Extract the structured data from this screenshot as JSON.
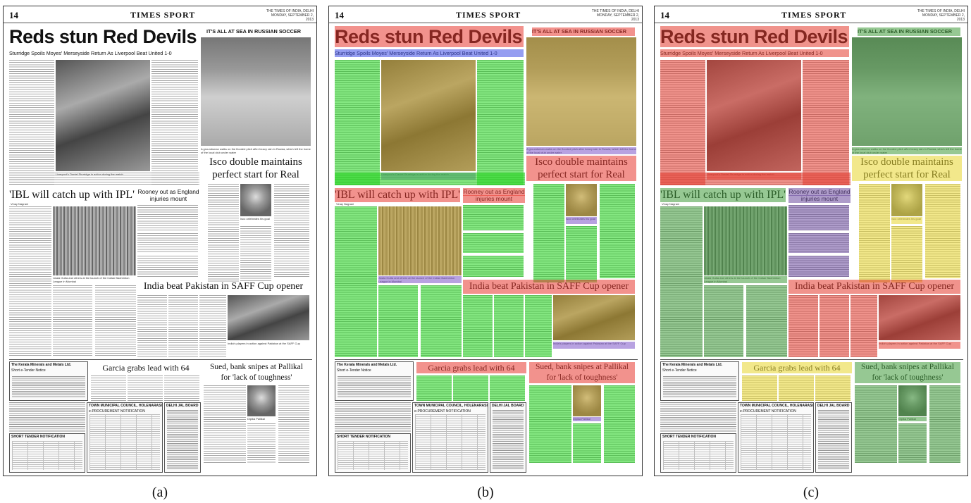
{
  "page": {
    "number": "14",
    "section": "TIMES SPORT",
    "edition": "THE TIMES OF INDIA, DELHI MONDAY, SEPTEMBER 2, 2013"
  },
  "captions": [
    "(a)",
    "(b)",
    "(c)"
  ],
  "articles": {
    "reds": {
      "headline": "Reds stun Red Devils",
      "subhead": "Sturridge Spoils Moyes' Merseyside Return As Liverpool Beat United 1-0",
      "photo_caption": "Liverpool's Daniel Sturridge in action during the match"
    },
    "russia": {
      "headline": "IT'S ALL AT SEA IN RUSSIAN SOCCER",
      "photo_caption": "A groundsman walks on the flooded pitch after heavy rain in Russia, which left the home of the local club under water"
    },
    "isco": {
      "headline_line1": "Isco double maintains",
      "headline_line2": "perfect start for Real",
      "photo_caption": "Isco celebrates his goal"
    },
    "ibl": {
      "headline": "'IBL will catch up with IPL'",
      "byline": "Vinay Nagrani",
      "photo_caption": "Jwala Gutta and others at the launch of the Indian Badminton League in Mumbai"
    },
    "rooney": {
      "headline_line1": "Rooney out as England",
      "headline_line2": "injuries mount"
    },
    "india": {
      "headline": "India beat Pakistan in SAFF Cup opener",
      "photo_caption": "India's players in action against Pakistan at the SAFF Cup"
    },
    "garcia": {
      "headline": "Garcia grabs lead with 64"
    },
    "sued": {
      "headline_line1": "Sued, bank snipes at Pallikal",
      "headline_line2": "for 'lack of toughness'",
      "photo_caption": "Dipika Pallikal"
    }
  },
  "ads": {
    "kerala": {
      "title": "The Kerala Minerals and Metals Ltd.",
      "subtitle": "Short e-Tender Notice"
    },
    "town": {
      "title": "TOWN MUNICIPAL COUNCIL, HOLENARASIPURA",
      "subtitle": "e-PROCUREMENT NOTIFICATION"
    },
    "short": {
      "title": "SHORT TENDER NOTIFICATION"
    },
    "side": {
      "title": "DELHI JAL BOARD"
    }
  },
  "colors": {
    "headline": "#e8392f",
    "body": "#1fd31a",
    "caption": "#7e56c9",
    "subhead": "#3e4de6",
    "photo": "#c9a227",
    "text_class2": "#e6d32f",
    "text_class3": "#5a9b4e",
    "figure_c_red": "#e33a2e",
    "figure_c_green": "#3f9a3a",
    "figure_c_yellow": "#e7d52c",
    "figure_c_purple": "#6b4a9e"
  }
}
